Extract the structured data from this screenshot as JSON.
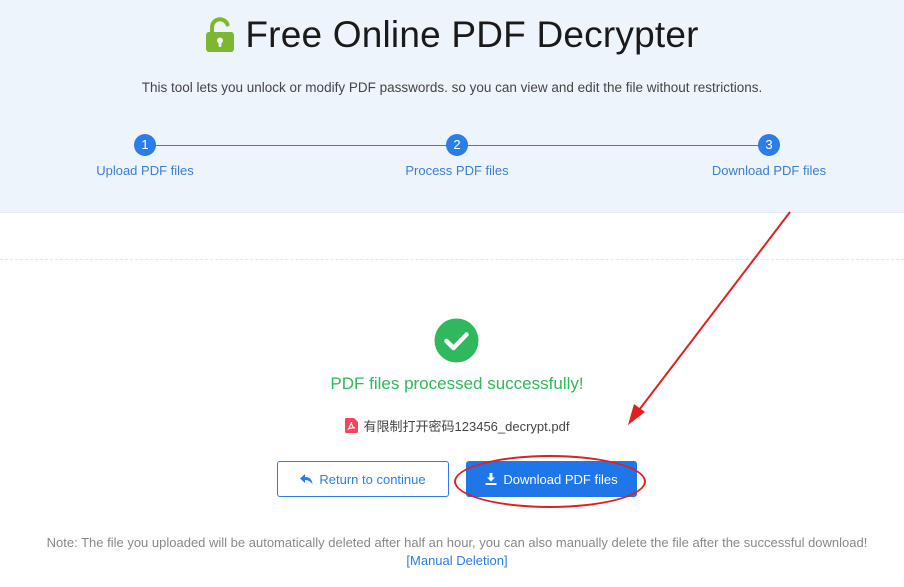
{
  "header": {
    "title": "Free Online PDF Decrypter",
    "subtitle": "This tool lets you unlock or modify PDF passwords. so you can view and edit the file without restrictions.",
    "icon": "unlock-icon",
    "icon_color": "#7cb82f"
  },
  "steps": [
    {
      "number": "1",
      "label": "Upload PDF files"
    },
    {
      "number": "2",
      "label": "Process PDF files"
    },
    {
      "number": "3",
      "label": "Download PDF files"
    }
  ],
  "result": {
    "status_icon": "check-circle-icon",
    "status_color": "#2fb85c",
    "message": "PDF files processed successfully!",
    "file_icon": "pdf-file-icon",
    "file_name": "有限制打开密码123456_decrypt.pdf"
  },
  "actions": {
    "return_label": "Return to continue",
    "download_label": "Download PDF files"
  },
  "footer": {
    "note": "Note: The file you uploaded will be automatically deleted after half an hour, you can also manually delete the file after the successful download!",
    "manual_delete_label": "[Manual Deletion]"
  },
  "colors": {
    "accent": "#2b7de9",
    "hero_bg": "#eef4fc",
    "annotation": "#e02020"
  }
}
